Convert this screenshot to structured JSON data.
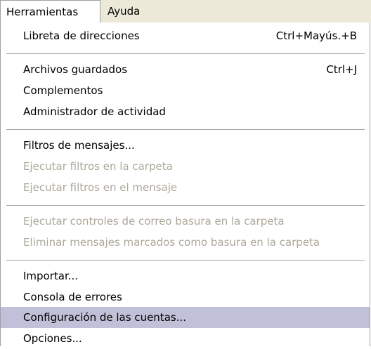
{
  "menubar": {
    "tools_label": "Herramientas",
    "help_label": "Ayuda"
  },
  "menu": {
    "items": [
      {
        "label": "Libreta de direcciones",
        "shortcut": "Ctrl+Mayús.+B",
        "enabled": true
      },
      {
        "label": "Archivos guardados",
        "shortcut": "Ctrl+J",
        "enabled": true
      },
      {
        "label": "Complementos",
        "shortcut": "",
        "enabled": true
      },
      {
        "label": "Administrador de actividad",
        "shortcut": "",
        "enabled": true
      },
      {
        "label": "Filtros de mensajes...",
        "shortcut": "",
        "enabled": true
      },
      {
        "label": "Ejecutar filtros en la carpeta",
        "shortcut": "",
        "enabled": false
      },
      {
        "label": "Ejecutar filtros en el mensaje",
        "shortcut": "",
        "enabled": false
      },
      {
        "label": "Ejecutar controles de correo basura en la carpeta",
        "shortcut": "",
        "enabled": false
      },
      {
        "label": "Eliminar mensajes marcados como basura en la carpeta",
        "shortcut": "",
        "enabled": false
      },
      {
        "label": "Importar...",
        "shortcut": "",
        "enabled": true
      },
      {
        "label": "Consola de errores",
        "shortcut": "",
        "enabled": true
      },
      {
        "label": "Configuración de las cuentas...",
        "shortcut": "",
        "enabled": true,
        "highlighted": true
      },
      {
        "label": "Opciones...",
        "shortcut": "",
        "enabled": true
      }
    ]
  },
  "colors": {
    "menubar_bg": "#ece9d8",
    "highlight_bg": "#c0c0d8",
    "disabled_text": "#aca899"
  }
}
